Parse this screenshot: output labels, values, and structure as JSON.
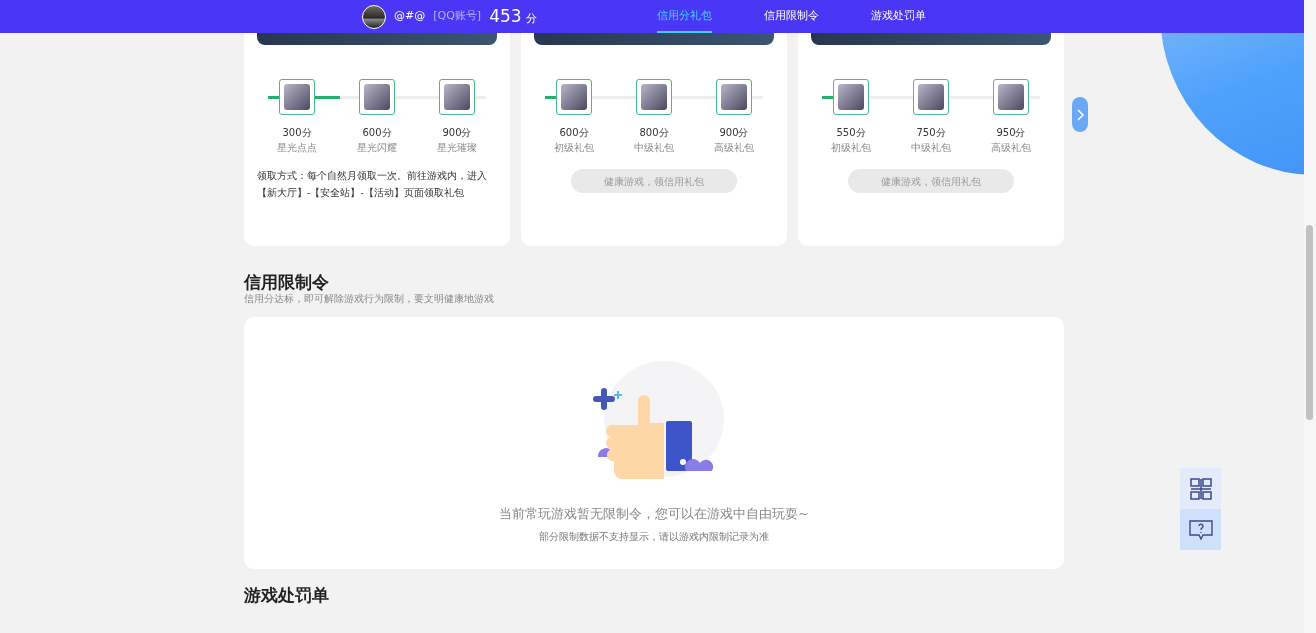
{
  "header": {
    "user_name": "@#@",
    "account_type": "[QQ账号]",
    "score": "453",
    "score_unit": "分",
    "tabs": [
      {
        "label": "信用分礼包",
        "selected": true
      },
      {
        "label": "信用限制令",
        "selected": false
      },
      {
        "label": "游戏处罚单",
        "selected": false
      }
    ]
  },
  "gift_cards": [
    {
      "level": 0.33,
      "tiers": [
        {
          "points": "300分",
          "name": "星光点点"
        },
        {
          "points": "600分",
          "name": "星光闪耀"
        },
        {
          "points": "900分",
          "name": "星光璀璨"
        }
      ],
      "footer": {
        "kind": "info",
        "text": "领取方式：每个自然月领取一次。前往游戏内，进入【新大厅】-【安全站】-【活动】页面领取礼包"
      }
    },
    {
      "level": 0.05,
      "tiers": [
        {
          "points": "600分",
          "name": "初级礼包"
        },
        {
          "points": "800分",
          "name": "中级礼包"
        },
        {
          "points": "900分",
          "name": "高级礼包"
        }
      ],
      "footer": {
        "kind": "button",
        "text": "健康游戏，领信用礼包",
        "disabled": true
      }
    },
    {
      "level": 0.05,
      "tiers": [
        {
          "points": "550分",
          "name": "初级礼包"
        },
        {
          "points": "750分",
          "name": "中级礼包"
        },
        {
          "points": "950分",
          "name": "高级礼包"
        }
      ],
      "footer": {
        "kind": "button",
        "text": "健康游戏，领信用礼包",
        "disabled": true
      }
    }
  ],
  "restriction_section": {
    "title": "信用限制令",
    "subtitle": "信用分达标，即可解除游戏行为限制，要文明健康地游戏",
    "empty_message": "当前常玩游戏暂无限制令，您可以在游戏中自由玩耍~",
    "note": "部分限制数据不支持显示，请以游戏内限制记录为准"
  },
  "penalty_section": {
    "title": "游戏处罚单"
  }
}
